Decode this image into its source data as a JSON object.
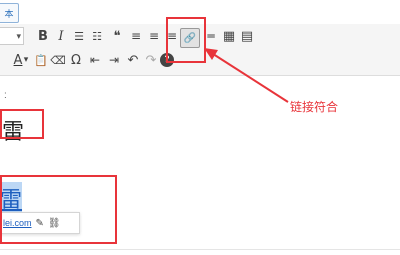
{
  "tabs": {
    "text_tab": "本"
  },
  "toolbar": {
    "row1": [
      {
        "name": "format-select-chevron",
        "icon": "chevron-down",
        "glyph": "▾"
      },
      {
        "name": "bold-button",
        "icon": "bold",
        "glyph": "B"
      },
      {
        "name": "italic-button",
        "icon": "italic",
        "glyph": "I"
      },
      {
        "name": "bullet-list-button",
        "icon": "bullet-list",
        "glyph": "☰"
      },
      {
        "name": "numbered-list-button",
        "icon": "numbered-list",
        "glyph": "☷"
      },
      {
        "name": "blockquote-button",
        "icon": "quote",
        "glyph": "❝"
      },
      {
        "name": "align-left-button",
        "icon": "align-left",
        "glyph": "≡"
      },
      {
        "name": "align-center-button",
        "icon": "align-center",
        "glyph": "≡"
      },
      {
        "name": "align-right-button",
        "icon": "align-right",
        "glyph": "≡"
      },
      {
        "name": "insert-link-button",
        "icon": "link",
        "glyph": "🔗"
      },
      {
        "name": "read-more-button",
        "icon": "read-more",
        "glyph": "═"
      },
      {
        "name": "toolbar-toggle-button",
        "icon": "keyboard",
        "glyph": "▦"
      },
      {
        "name": "fullscreen-button",
        "icon": "fullscreen",
        "glyph": "▤"
      }
    ],
    "row2": [
      {
        "name": "text-color-button",
        "icon": "text-color",
        "glyph": "A"
      },
      {
        "name": "text-color-chevron",
        "icon": "chevron-down",
        "glyph": "▾"
      },
      {
        "name": "paste-text-button",
        "icon": "clipboard",
        "glyph": "📋"
      },
      {
        "name": "clear-format-button",
        "icon": "eraser",
        "glyph": "⌫"
      },
      {
        "name": "special-char-button",
        "icon": "omega",
        "glyph": "Ω"
      },
      {
        "name": "outdent-button",
        "icon": "outdent",
        "glyph": "⇤"
      },
      {
        "name": "indent-button",
        "icon": "indent",
        "glyph": "⇥"
      },
      {
        "name": "undo-button",
        "icon": "undo",
        "glyph": "↶"
      },
      {
        "name": "redo-button",
        "icon": "redo",
        "glyph": "↷"
      },
      {
        "name": "help-button",
        "icon": "help",
        "glyph": "?"
      }
    ]
  },
  "content": {
    "bullet": ":",
    "char_plain": "雷",
    "char_linked": "雷",
    "popup_url": "lei.com"
  },
  "annotation": {
    "label": "链接符合"
  },
  "colors": {
    "highlight": "#e8343a",
    "link": "#1e5fbf"
  }
}
